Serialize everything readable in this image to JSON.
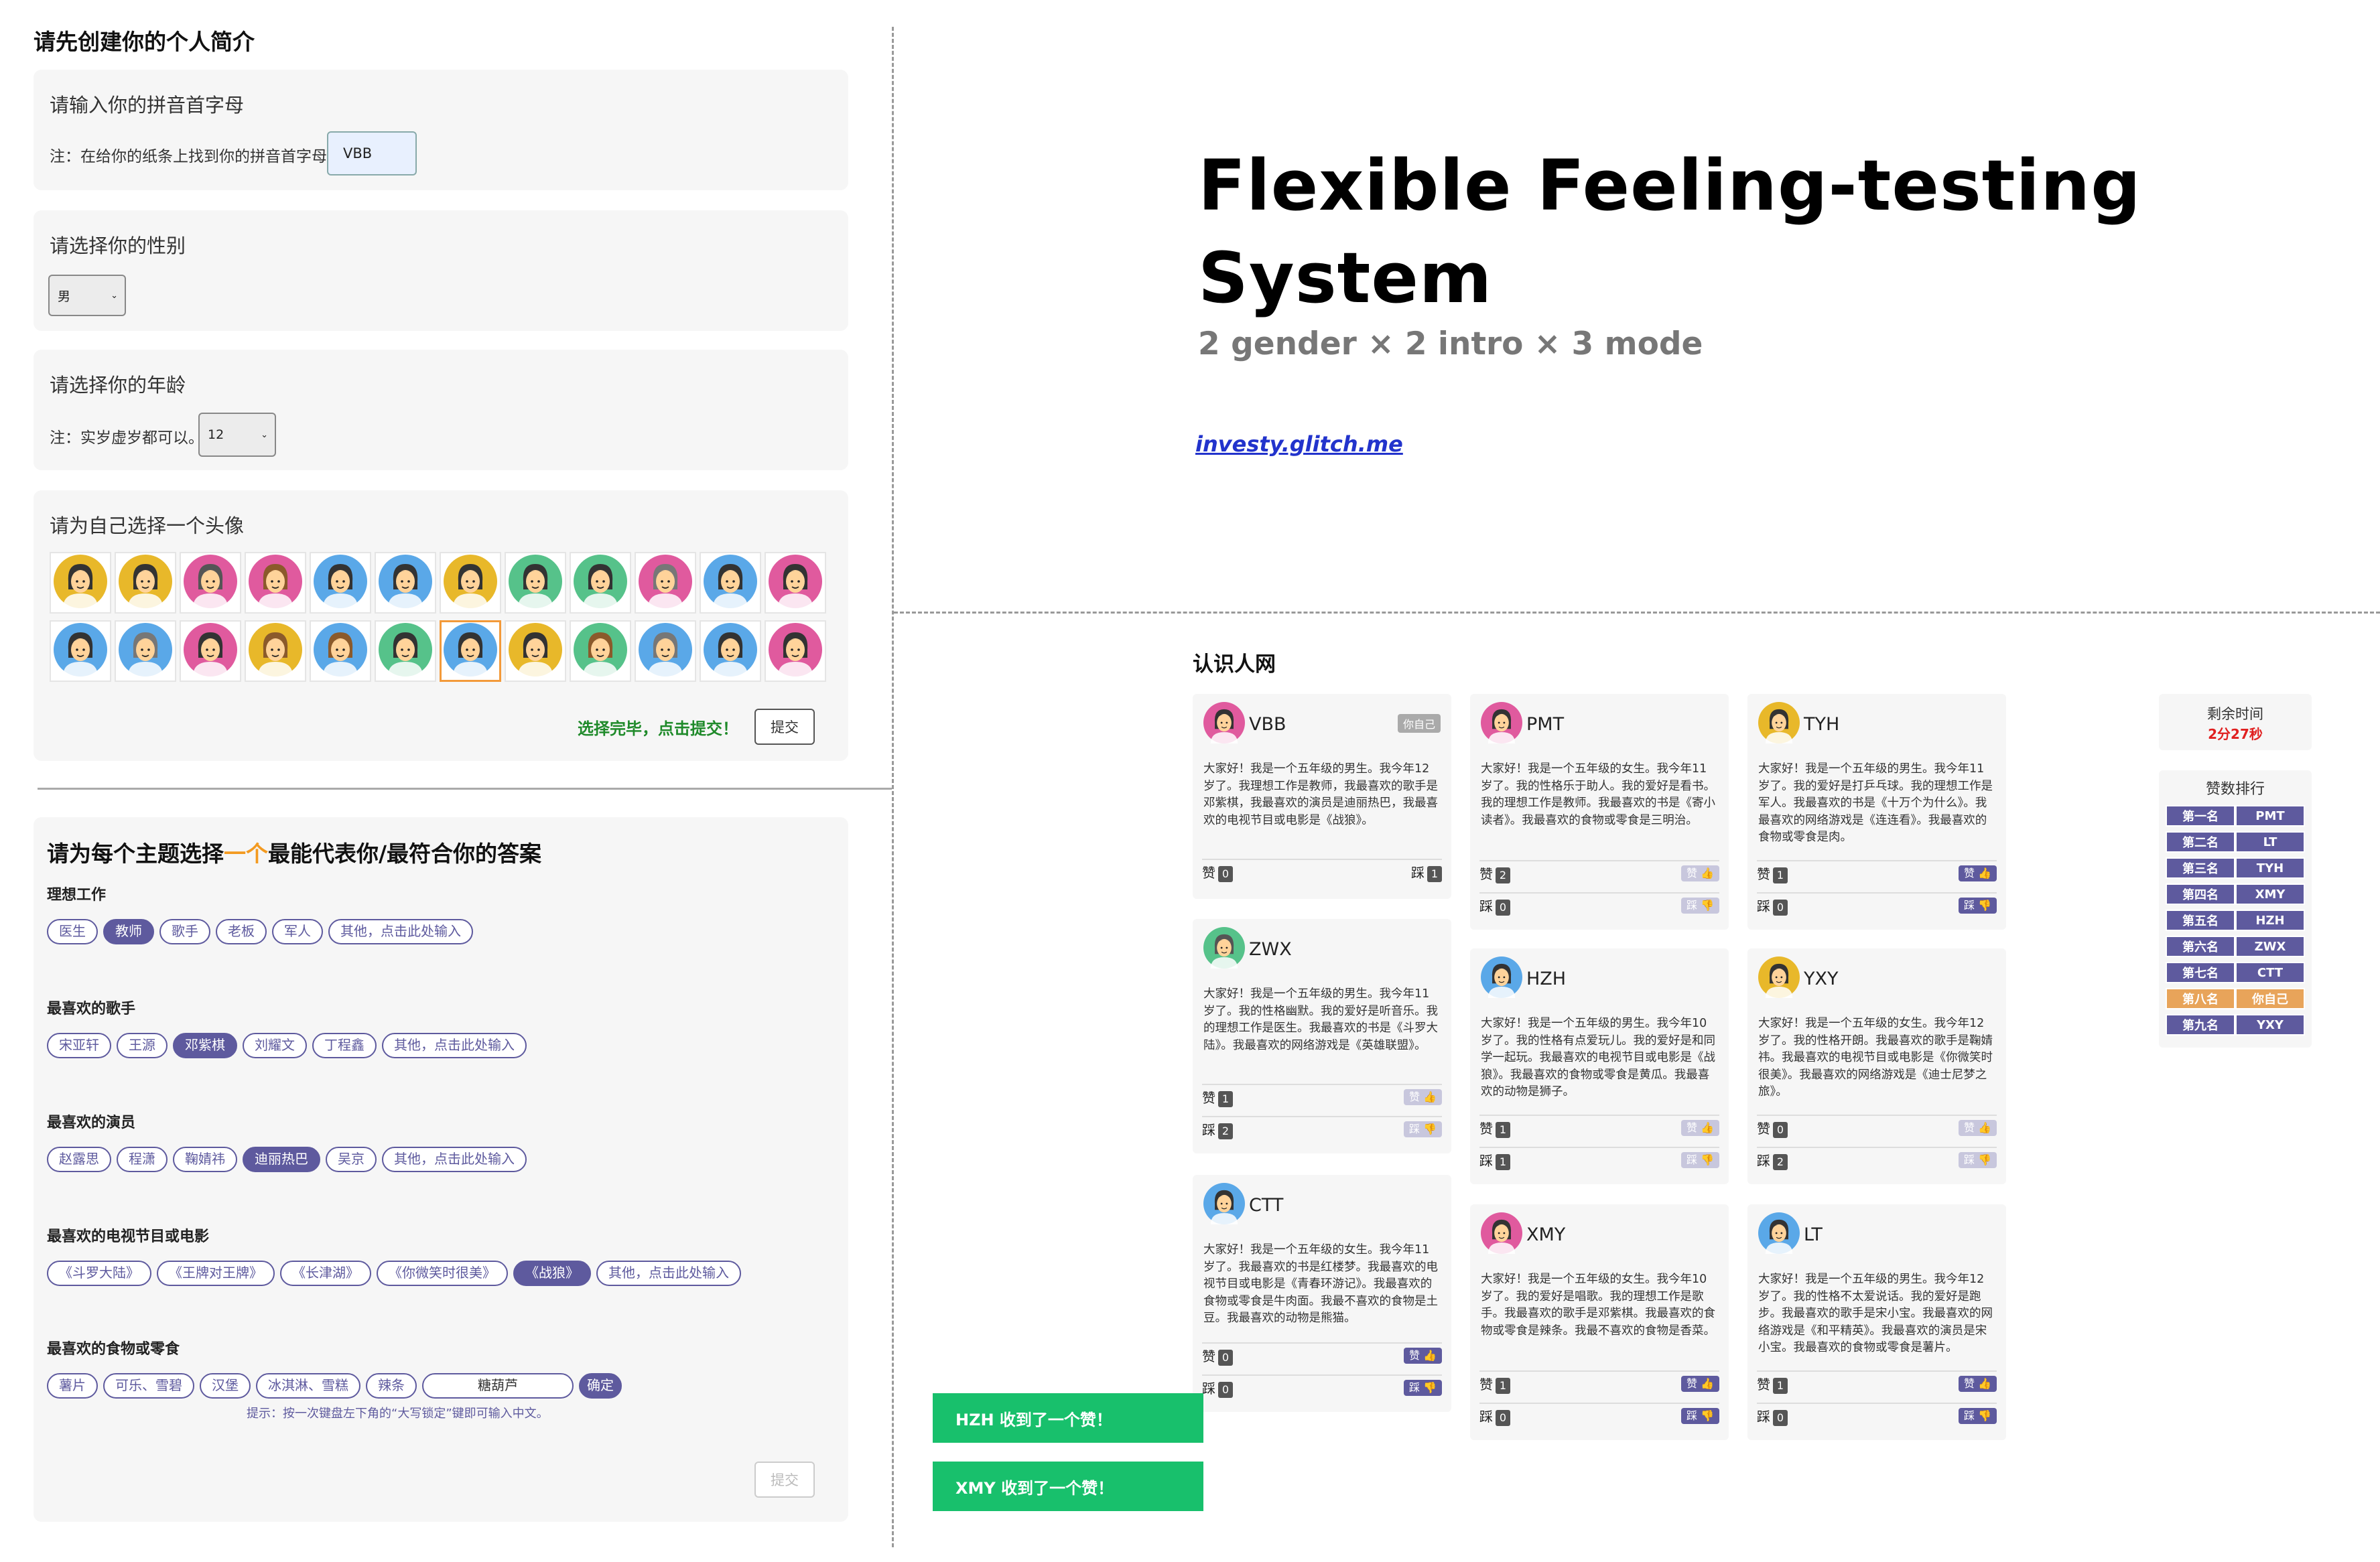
{
  "profile": {
    "heading": "请先创建你的个人简介",
    "pinyin": {
      "title": "请输入你的拼音首字母",
      "note": "注：在给你的纸条上找到你的拼音首字母。",
      "value": "VBB"
    },
    "gender": {
      "title": "请选择你的性别",
      "value": "男"
    },
    "age": {
      "title": "请选择你的年龄",
      "note": "注：实岁虚岁都可以。",
      "value": "12"
    },
    "avatar": {
      "title": "请为自己选择一个头像",
      "selected_index": 18,
      "hint": "选择完毕，点击提交！",
      "submit": "提交"
    }
  },
  "questions": {
    "heading_pre": "请为每个主题选择",
    "heading_hl": "一个",
    "heading_post": "最能代表你/最符合你的答案",
    "items": [
      {
        "label": "理想工作",
        "options": [
          "医生",
          "教师",
          "歌手",
          "老板",
          "军人",
          "其他，点击此处输入"
        ],
        "selected": 1
      },
      {
        "label": "最喜欢的歌手",
        "options": [
          "宋亚轩",
          "王源",
          "邓紫棋",
          "刘耀文",
          "丁程鑫",
          "其他，点击此处输入"
        ],
        "selected": 2
      },
      {
        "label": "最喜欢的演员",
        "options": [
          "赵露思",
          "程潇",
          "鞠婧祎",
          "迪丽热巴",
          "吴京",
          "其他，点击此处输入"
        ],
        "selected": 3
      },
      {
        "label": "最喜欢的电视节目或电影",
        "options": [
          "《斗罗大陆》",
          "《王牌对王牌》",
          "《长津湖》",
          "《你微笑时很美》",
          "《战狼》",
          "其他，点击此处输入"
        ],
        "selected": 4
      },
      {
        "label": "最喜欢的食物或零食",
        "options": [
          "薯片",
          "可乐、雪碧",
          "汉堡",
          "冰淇淋、雪糕",
          "辣条"
        ],
        "selected": -1,
        "input_value": "糖葫芦",
        "confirm": "确定",
        "tip": "提示：按一次键盘左下角的“大写锁定”键即可输入中文。"
      }
    ],
    "submit": "提交"
  },
  "title": {
    "line1": "Flexible Feeling-testing",
    "line2": "System",
    "subtitle": "2 gender × 2 intro × 3 mode",
    "link": "investy.glitch.me"
  },
  "network": {
    "heading": "认识人网",
    "me_badge": "你自己",
    "like_label": "赞",
    "dislike_label": "踩",
    "like_btn": "赞 👍",
    "dislike_btn": "踩 👎",
    "people": [
      {
        "name": "VBB",
        "me": true,
        "intro": "大家好！我是一个五年级的男生。我今年12岁了。我理想工作是教师，我最喜欢的歌手是邓紫棋，我最喜欢的演员是迪丽热巴，我最喜欢的电视节目或电影是《战狼》。",
        "likes": "0",
        "dislikes": "1",
        "av": "#e05a9e",
        "hair": "#333",
        "skin": "#ffd39a"
      },
      {
        "name": "PMT",
        "intro": "大家好！我是一个五年级的女生。我今年11岁了。我的性格乐于助人。我的爱好是看书。我的理想工作是教师。我最喜欢的书是《寄小读者》。我最喜欢的食物或零食是三明治。",
        "likes": "2",
        "dislikes": "0",
        "av": "#e05a9e",
        "hair": "#333",
        "skin": "#ffd39a"
      },
      {
        "name": "TYH",
        "intro": "大家好！我是一个五年级的男生。我今年11岁了。我的爱好是打乒乓球。我的理想工作是军人。我最喜欢的书是《十万个为什么》。我最喜欢的网络游戏是《连连看》。我最喜欢的食物或零食是肉。",
        "likes": "1",
        "dislikes": "0",
        "av": "#e8b82a",
        "hair": "#333",
        "skin": "#ffd39a"
      },
      {
        "name": "ZWX",
        "intro": "大家好！我是一个五年级的男生。我今年11岁了。我的性格幽默。我的爱好是听音乐。我的理想工作是医生。我最喜欢的书是《斗罗大陆》。我最喜欢的网络游戏是《英雄联盟》。",
        "likes": "1",
        "dislikes": "2",
        "av": "#56c28a",
        "hair": "#555",
        "skin": "#ffd39a"
      },
      {
        "name": "HZH",
        "intro": "大家好！我是一个五年级的男生。我今年10岁了。我的性格有点爱玩儿。我的爱好是和同学一起玩。我最喜欢的电视节目或电影是《战狼》。我最喜欢的食物或零食是黄瓜。我最喜欢的动物是狮子。",
        "likes": "1",
        "dislikes": "1",
        "av": "#5aa8e8",
        "hair": "#333",
        "skin": "#ffd39a"
      },
      {
        "name": "YXY",
        "intro": "大家好！我是一个五年级的女生。我今年12岁了。我的性格开朗。我最喜欢的歌手是鞠婧祎。我最喜欢的电视节目或电影是《你微笑时很美》。我最喜欢的网络游戏是《迪士尼梦之旅》。",
        "likes": "0",
        "dislikes": "2",
        "av": "#e8b82a",
        "hair": "#333",
        "skin": "#ffd39a"
      },
      {
        "name": "CTT",
        "intro": "大家好！我是一个五年级的女生。我今年11岁了。我最喜欢的书是红楼梦。我最喜欢的电视节目或电影是《青春环游记》。我最喜欢的食物或零食是牛肉面。我最不喜欢的食物是土豆。我最喜欢的动物是熊猫。",
        "likes": "0",
        "dislikes": "0",
        "av": "#5aa8e8",
        "hair": "#333",
        "skin": "#ffd39a"
      },
      {
        "name": "XMY",
        "intro": "大家好！我是一个五年级的女生。我今年10岁了。我的爱好是唱歌。我的理想工作是歌手。我最喜欢的歌手是邓紫棋。我最喜欢的食物或零食是辣条。我最不喜欢的食物是香菜。",
        "likes": "1",
        "dislikes": "0",
        "av": "#e05a9e",
        "hair": "#333",
        "skin": "#ffd39a"
      },
      {
        "name": "LT",
        "intro": "大家好！我是一个五年级的男生。我今年12岁了。我的性格不太爱说话。我的爱好是跑步。我最喜欢的歌手是宋小宝。我最喜欢的网络游戏是《和平精英》。我最喜欢的演员是宋小宝。我最喜欢的食物或零食是薯片。",
        "likes": "1",
        "dislikes": "0",
        "av": "#5aa8e8",
        "hair": "#333",
        "skin": "#ffd39a"
      }
    ]
  },
  "timer": {
    "label": "剩余时间",
    "value": "2分27秒"
  },
  "ranking": {
    "title": "赞数排行",
    "rows": [
      {
        "rank": "第一名",
        "name": "PMT"
      },
      {
        "rank": "第二名",
        "name": "LT"
      },
      {
        "rank": "第三名",
        "name": "TYH"
      },
      {
        "rank": "第四名",
        "name": "XMY"
      },
      {
        "rank": "第五名",
        "name": "HZH"
      },
      {
        "rank": "第六名",
        "name": "ZWX"
      },
      {
        "rank": "第七名",
        "name": "CTT"
      },
      {
        "rank": "第八名",
        "name": "你自己",
        "me": true
      },
      {
        "rank": "第九名",
        "name": "YXY"
      }
    ]
  },
  "toasts": [
    "HZH 收到了一个赞！",
    "XMY 收到了一个赞！"
  ],
  "avatars": [
    {
      "bg": "#e8b82a",
      "hair": "#333"
    },
    {
      "bg": "#e8b82a",
      "hair": "#333"
    },
    {
      "bg": "#e05a9e",
      "hair": "#555"
    },
    {
      "bg": "#e05a9e",
      "hair": "#8b5a2b"
    },
    {
      "bg": "#5aa8e8",
      "hair": "#333"
    },
    {
      "bg": "#5aa8e8",
      "hair": "#333"
    },
    {
      "bg": "#e8b82a",
      "hair": "#333"
    },
    {
      "bg": "#56c28a",
      "hair": "#333"
    },
    {
      "bg": "#56c28a",
      "hair": "#333"
    },
    {
      "bg": "#e05a9e",
      "hair": "#777"
    },
    {
      "bg": "#5aa8e8",
      "hair": "#333"
    },
    {
      "bg": "#e05a9e",
      "hair": "#333"
    },
    {
      "bg": "#5aa8e8",
      "hair": "#333"
    },
    {
      "bg": "#5aa8e8",
      "hair": "#777"
    },
    {
      "bg": "#e05a9e",
      "hair": "#333"
    },
    {
      "bg": "#e8b82a",
      "hair": "#8b5a2b"
    },
    {
      "bg": "#5aa8e8",
      "hair": "#8b5a2b"
    },
    {
      "bg": "#56c28a",
      "hair": "#333"
    },
    {
      "bg": "#5aa8e8",
      "hair": "#333"
    },
    {
      "bg": "#e8b82a",
      "hair": "#333"
    },
    {
      "bg": "#56c28a",
      "hair": "#8b5a2b"
    },
    {
      "bg": "#5aa8e8",
      "hair": "#777"
    },
    {
      "bg": "#5aa8e8",
      "hair": "#333"
    },
    {
      "bg": "#e05a9e",
      "hair": "#333"
    }
  ]
}
